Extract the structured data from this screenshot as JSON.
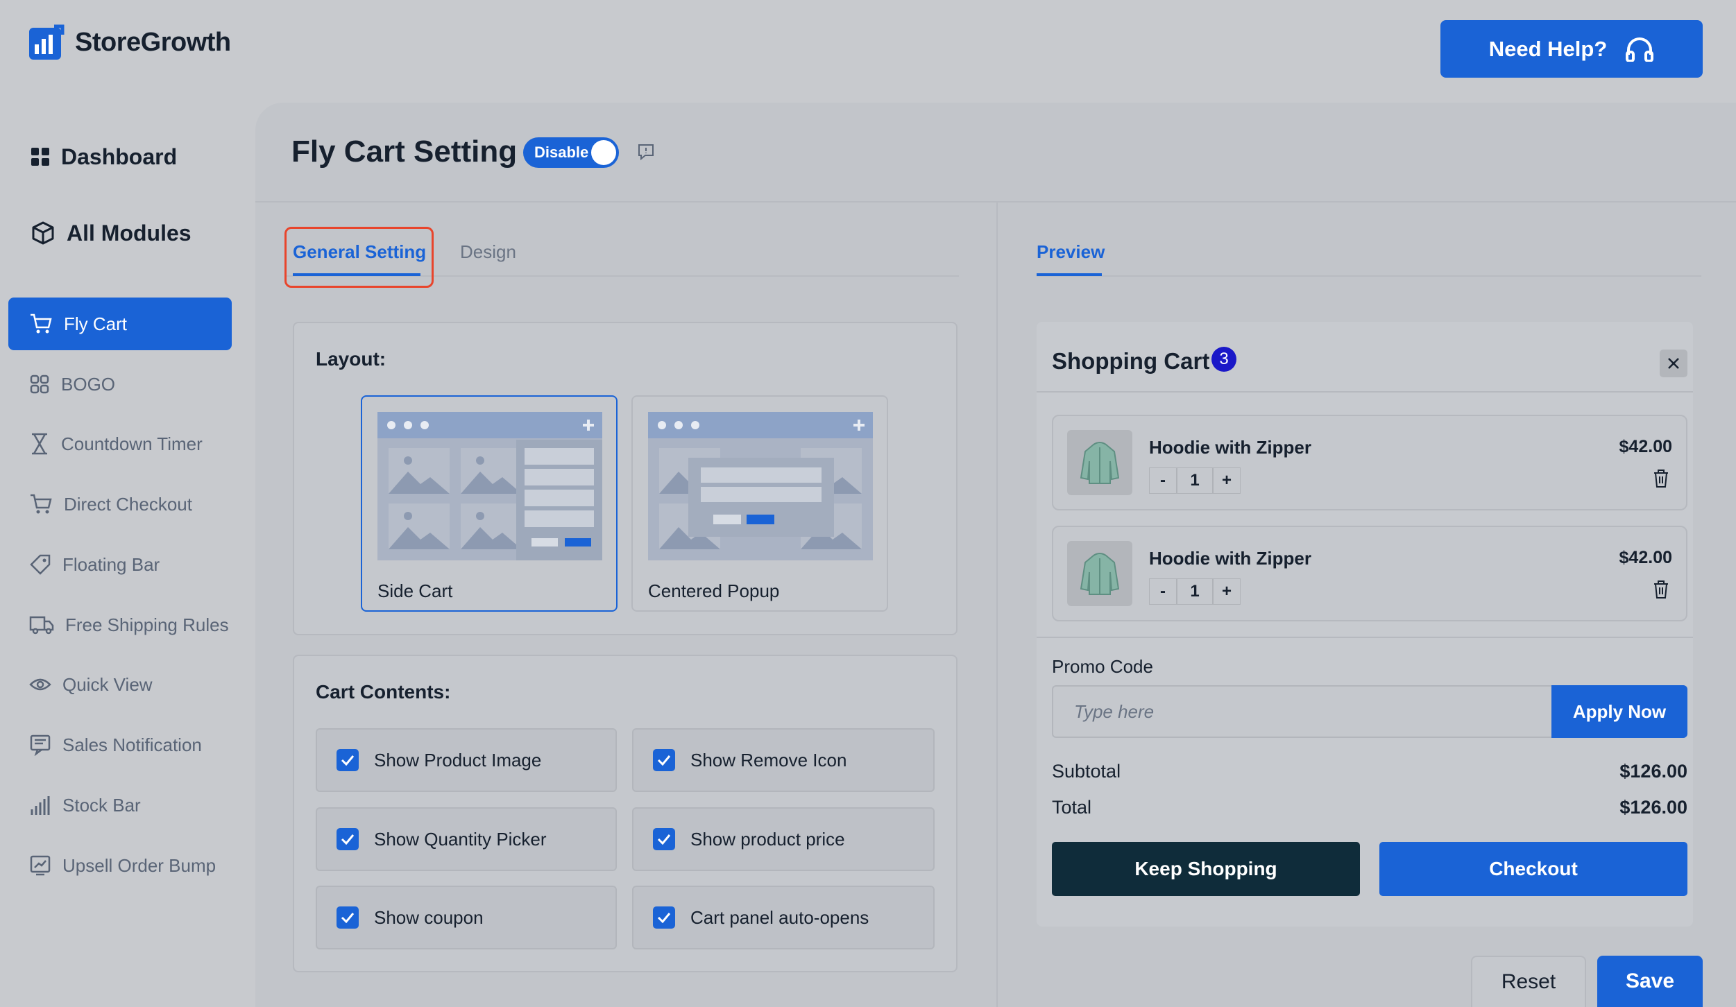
{
  "header": {
    "brand": "StoreGrowth",
    "help_label": "Need Help?"
  },
  "sidebar": {
    "top": [
      {
        "label": "Dashboard",
        "icon": "dashboard-icon"
      },
      {
        "label": "All Modules",
        "icon": "cube-icon"
      }
    ],
    "items": [
      {
        "label": "Fly Cart",
        "icon": "cart-icon",
        "active": true
      },
      {
        "label": "BOGO",
        "icon": "bogo-icon"
      },
      {
        "label": "Countdown Timer",
        "icon": "hourglass-icon"
      },
      {
        "label": "Direct Checkout",
        "icon": "cart-icon"
      },
      {
        "label": "Floating Bar",
        "icon": "tag-icon"
      },
      {
        "label": "Free Shipping Rules",
        "icon": "truck-icon"
      },
      {
        "label": "Quick View",
        "icon": "eye-icon"
      },
      {
        "label": "Sales Notification",
        "icon": "notification-icon"
      },
      {
        "label": "Stock Bar",
        "icon": "bar-chart-icon"
      },
      {
        "label": "Upsell Order Bump",
        "icon": "trend-icon"
      }
    ]
  },
  "page": {
    "title": "Fly Cart Setting",
    "toggle_label": "Disable"
  },
  "tabs": {
    "general": "General Setting",
    "design": "Design",
    "preview": "Preview"
  },
  "layout": {
    "title": "Layout:",
    "options": [
      "Side Cart",
      "Centered Popup"
    ],
    "selected": "Side Cart"
  },
  "cart_contents": {
    "title": "Cart Contents:",
    "options": [
      {
        "label": "Show Product Image",
        "checked": true
      },
      {
        "label": "Show Remove Icon",
        "checked": true
      },
      {
        "label": "Show Quantity Picker",
        "checked": true
      },
      {
        "label": "Show product price",
        "checked": true
      },
      {
        "label": "Show coupon",
        "checked": true
      },
      {
        "label": "Cart panel auto-opens",
        "checked": true
      }
    ]
  },
  "preview": {
    "cart_title": "Shopping Cart",
    "count": "3",
    "items": [
      {
        "name": "Hoodie with Zipper",
        "price": "$42.00",
        "qty": "1"
      },
      {
        "name": "Hoodie with Zipper",
        "price": "$42.00",
        "qty": "1"
      }
    ],
    "qty_minus": "-",
    "qty_plus": "+",
    "promo_label": "Promo Code",
    "promo_placeholder": "Type here",
    "apply_label": "Apply Now",
    "subtotal_label": "Subtotal",
    "subtotal_value": "$126.00",
    "total_label": "Total",
    "total_value": "$126.00",
    "keep_shopping": "Keep Shopping",
    "checkout": "Checkout"
  },
  "footer": {
    "reset": "Reset",
    "save": "Save"
  },
  "colors": {
    "accent": "#1a63d6",
    "dark_button": "#0f2c3a",
    "highlight": "#e8452c",
    "badge": "#1a18c8"
  }
}
